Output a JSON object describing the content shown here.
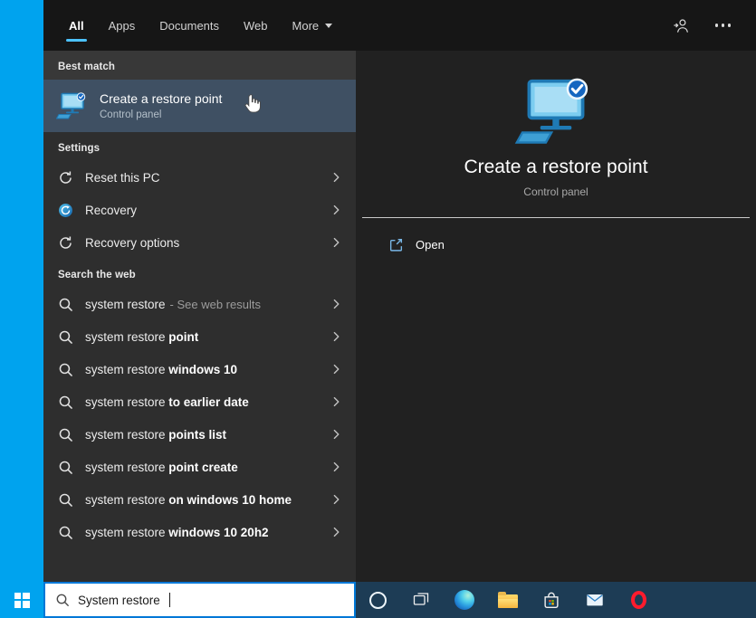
{
  "colors": {
    "accent_strip": "#00a3ee",
    "tab_underline": "#4cc2ff",
    "selection_background": "#3f5063",
    "search_box_border": "#0078d7",
    "taskbar_background": "#1d3c55"
  },
  "header": {
    "active_tab": "All",
    "tabs": [
      {
        "label": "All"
      },
      {
        "label": "Apps"
      },
      {
        "label": "Documents"
      },
      {
        "label": "Web"
      },
      {
        "label": "More"
      }
    ]
  },
  "left_panel": {
    "best_match": {
      "section_label": "Best match",
      "title": "Create a restore point",
      "subtitle": "Control panel",
      "icon": "restore-point-icon"
    },
    "settings": {
      "section_label": "Settings",
      "items": [
        {
          "label": "Reset this PC",
          "icon": "reset-pc-icon"
        },
        {
          "label": "Recovery",
          "icon": "recovery-icon"
        },
        {
          "label": "Recovery options",
          "icon": "recovery-options-icon"
        }
      ]
    },
    "web": {
      "section_label": "Search the web",
      "items": [
        {
          "query": "system restore",
          "completion": "",
          "note": "- See web results"
        },
        {
          "query": "system restore ",
          "completion": "point",
          "note": ""
        },
        {
          "query": "system restore ",
          "completion": "windows 10",
          "note": ""
        },
        {
          "query": "system restore ",
          "completion": "to earlier date",
          "note": ""
        },
        {
          "query": "system restore ",
          "completion": "points list",
          "note": ""
        },
        {
          "query": "system restore ",
          "completion": "point create",
          "note": ""
        },
        {
          "query": "system restore ",
          "completion": "on windows 10 home",
          "note": ""
        },
        {
          "query": "system restore ",
          "completion": "windows 10 20h2",
          "note": ""
        }
      ]
    }
  },
  "preview": {
    "title": "Create a restore point",
    "subtitle": "Control panel",
    "open_label": "Open",
    "icon": "restore-point-icon"
  },
  "taskbar": {
    "search_value": "System restore",
    "buttons": [
      "cortana",
      "task-view",
      "edge",
      "file-explorer",
      "store",
      "mail",
      "opera"
    ]
  }
}
